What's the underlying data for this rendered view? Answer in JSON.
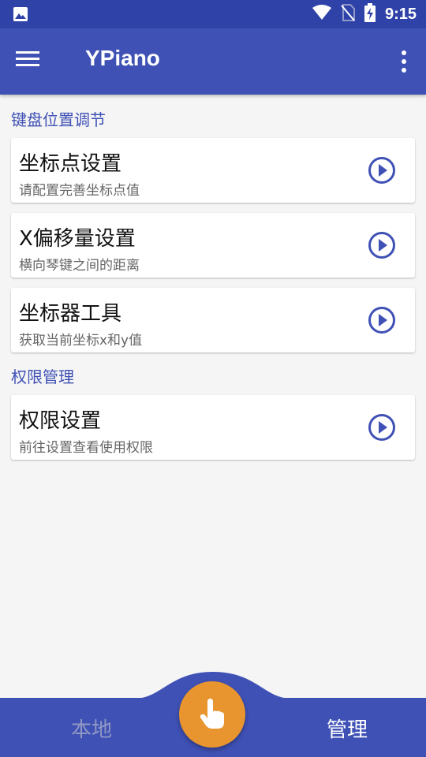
{
  "status_bar": {
    "time": "9:15",
    "icons": [
      "image-icon",
      "wifi-icon",
      "no-sim-icon",
      "battery-charging-icon"
    ]
  },
  "app_bar": {
    "title": "YPiano",
    "icons": [
      "menu-icon",
      "more-vert-icon"
    ]
  },
  "sections": [
    {
      "title": "键盘位置调节",
      "items": [
        {
          "title": "坐标点设置",
          "subtitle": "请配置完善坐标点值"
        },
        {
          "title": "X偏移量设置",
          "subtitle": "横向琴键之间的距离"
        },
        {
          "title": "坐标器工具",
          "subtitle": "获取当前坐标x和y值"
        }
      ]
    },
    {
      "title": "权限管理",
      "items": [
        {
          "title": "权限设置",
          "subtitle": "前往设置查看使用权限"
        }
      ]
    }
  ],
  "bottom_nav": {
    "local_label": "本地",
    "manage_label": "管理",
    "fab_icon": "touch-hand-icon"
  },
  "colors": {
    "primary": "#3f51b5",
    "status_bar": "#2f42a8",
    "accent": "#e8952f",
    "background": "#f5f5f5"
  }
}
